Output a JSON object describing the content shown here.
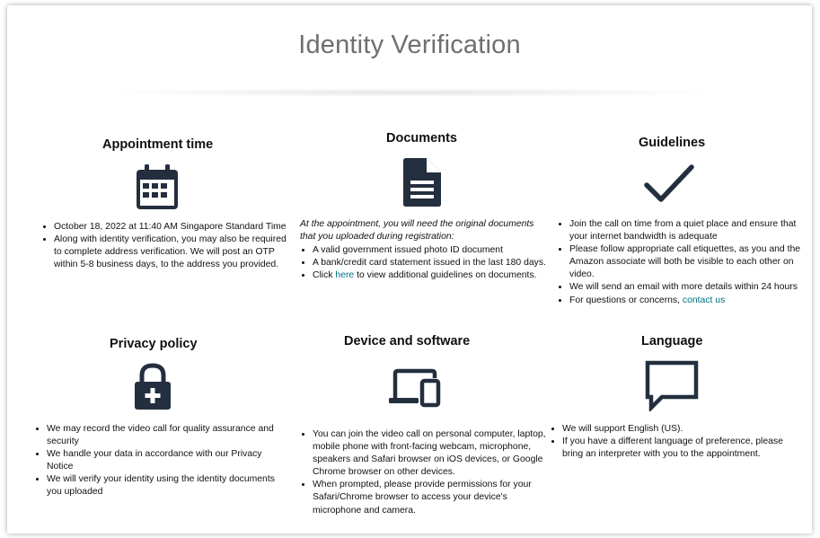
{
  "page": {
    "title": "Identity Verification"
  },
  "appointment": {
    "title": "Appointment time",
    "icon": "calendar-icon",
    "items": [
      "October 18, 2022 at 11:40 AM Singapore Standard Time",
      "Along with identity verification, you may also be required to complete address verification. We will post an OTP within 5-8 business days, to the address you provided."
    ]
  },
  "documents": {
    "title": "Documents",
    "icon": "document-icon",
    "intro": "At the appointment, you will need the original documents that you uploaded during registration:",
    "items": [
      "A valid government issued photo ID document",
      "A bank/credit card statement issued in the last 180 days."
    ],
    "click_prefix": "Click ",
    "click_link": "here",
    "click_suffix": " to view additional guidelines on documents."
  },
  "guidelines": {
    "title": "Guidelines",
    "icon": "checkmark-icon",
    "items": [
      "Join the call on time from a quiet place and ensure that your internet bandwidth is adequate",
      "Please follow appropriate call etiquettes, as you and the Amazon associate will both be visible to each other on video.",
      "We will send an email with more details within 24 hours"
    ],
    "contact_prefix": "For questions or concerns, ",
    "contact_link": "contact us"
  },
  "privacy": {
    "title": "Privacy policy",
    "icon": "lock-plus-icon",
    "items": [
      "We may record the video call for quality assurance and security",
      "We handle your data in accordance with our Privacy Notice",
      "We will verify your identity using the identity documents you uploaded"
    ]
  },
  "device": {
    "title": "Device and software",
    "icon": "devices-icon",
    "items": [
      "You can join the video call on personal computer, laptop, mobile phone with front-facing webcam, microphone, speakers and Safari browser on iOS devices, or Google Chrome browser on other devices.",
      "When prompted, please provide permissions for your Safari/Chrome browser to access your device's microphone and camera."
    ]
  },
  "language": {
    "title": "Language",
    "icon": "chat-bubble-icon",
    "items": [
      "We will support English (US).",
      "If you have a different language of preference, please bring an interpreter with you to the appointment."
    ]
  },
  "colors": {
    "icon": "#232f3e",
    "link": "#007185",
    "title": "#6f6f6f"
  }
}
